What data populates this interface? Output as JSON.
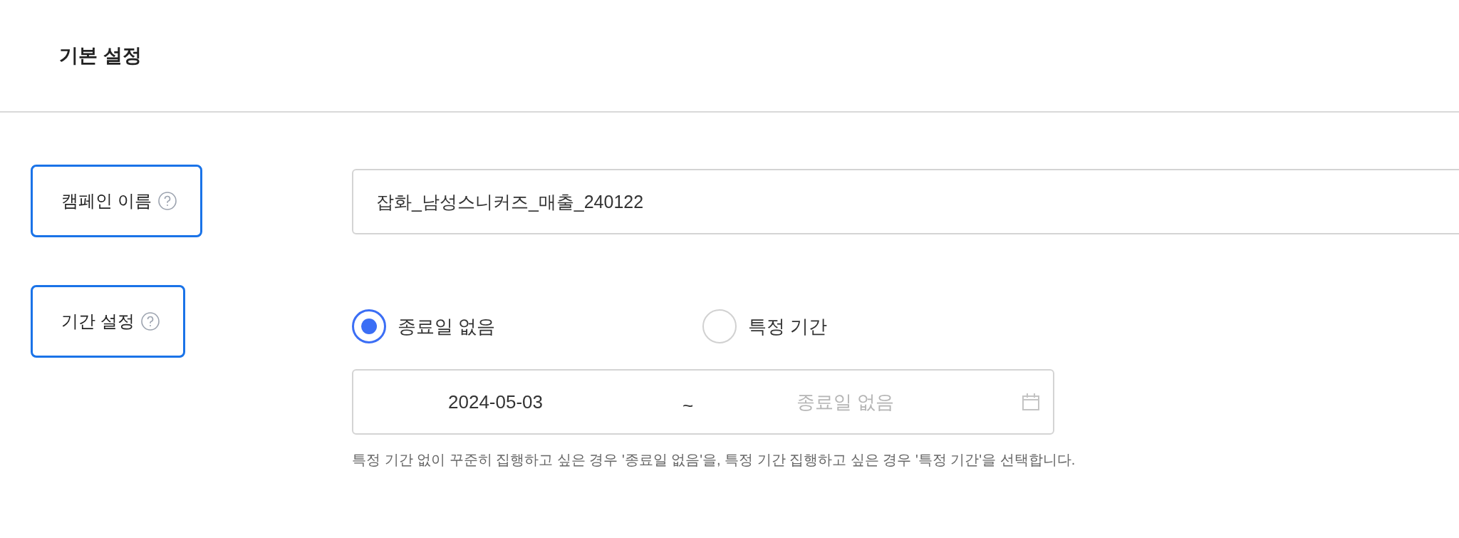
{
  "section_title": "기본 설정",
  "fields": [
    {
      "label": "캠페인 이름",
      "kind": "text",
      "value": "잡화_남성스니커즈_매출_240122"
    },
    {
      "label": "기간 설정",
      "kind": "period",
      "options": [
        {
          "label": "종료일 없음",
          "selected": true
        },
        {
          "label": "특정 기간",
          "selected": false
        }
      ],
      "start_date": "2024-05-03",
      "separator": "~",
      "end_placeholder": "종료일 없음",
      "help": "특정 기간 없이 꾸준히 집행하고 싶은 경우 '종료일 없음'을, 특정 기간 집행하고 싶은 경우 '특정 기간'을 선택합니다."
    }
  ]
}
